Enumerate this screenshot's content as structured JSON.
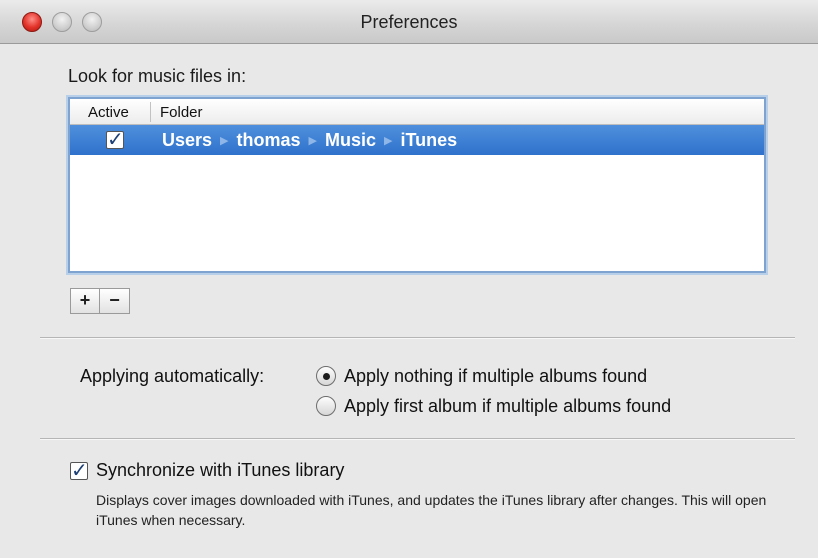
{
  "window": {
    "title": "Preferences"
  },
  "folders": {
    "label": "Look for music files in:",
    "columns": {
      "active": "Active",
      "folder": "Folder"
    },
    "rows": [
      {
        "active": true,
        "path": [
          "Users",
          "thomas",
          "Music",
          "iTunes"
        ]
      }
    ],
    "add_label": "+",
    "remove_label": "−"
  },
  "applying": {
    "label": "Applying automatically:",
    "options": [
      {
        "label": "Apply nothing if multiple albums found",
        "selected": true
      },
      {
        "label": "Apply first album if multiple albums found",
        "selected": false
      }
    ]
  },
  "sync": {
    "label": "Synchronize with iTunes library",
    "checked": true,
    "description": "Displays cover images downloaded with iTunes, and updates the iTunes library after changes. This will open iTunes when necessary."
  },
  "colors": {
    "selection": "#3a7bd5",
    "focus_ring": "#7fa3d0"
  }
}
